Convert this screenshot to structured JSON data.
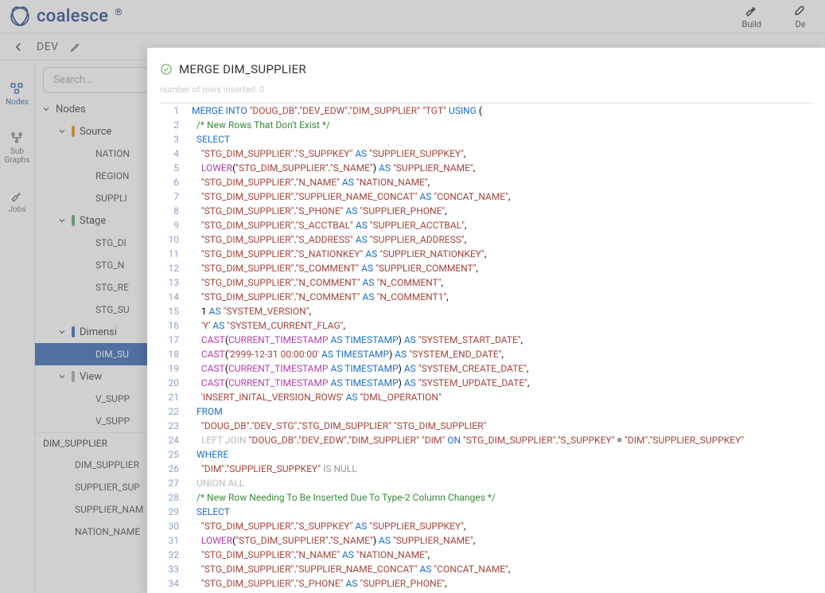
{
  "logo_text": "coalesce",
  "topbar": {
    "build": "Build",
    "deploy": "De"
  },
  "subbar": {
    "env": "DEV"
  },
  "rail": {
    "nodes": "Nodes",
    "subgraphs": "Sub\nGraphs",
    "jobs": "Jobs"
  },
  "search": {
    "placeholder": "Search..."
  },
  "tree": {
    "root": "Nodes",
    "source": {
      "label": "Source",
      "items": [
        "NATION",
        "REGION",
        "SUPPLI"
      ]
    },
    "stage": {
      "label": "Stage",
      "items": [
        "STG_DI",
        "STG_N",
        "STG_RE",
        "STG_SU"
      ]
    },
    "dimension": {
      "label": "Dimensi",
      "items": [
        "DIM_SU"
      ]
    },
    "view": {
      "label": "View",
      "items": [
        "V_SUPP",
        "V_SUPP"
      ]
    }
  },
  "detail": {
    "head": "DIM_SUPPLIER",
    "cols": [
      "DIM_SUPPLIER",
      "SUPPLIER_SUP",
      "SUPPLIER_NAM",
      "NATION_NAME"
    ]
  },
  "modal": {
    "title": "MERGE DIM_SUPPLIER",
    "status": "number of rows inserted: 0",
    "lines": [
      {
        "n": 1,
        "h": "<span class='tok-kw'>MERGE</span> <span class='tok-kw'>INTO</span> <span class='tok-str'>\"DOUG_DB\"</span>.<span class='tok-str'>\"DEV_EDW\"</span>.<span class='tok-str'>\"DIM_SUPPLIER\"</span> <span class='tok-str'>\"TGT\"</span> <span class='tok-kw'>USING</span> ("
      },
      {
        "n": 2,
        "h": "  <span class='tok-com'>/* New Rows That Don't Exist */</span>"
      },
      {
        "n": 3,
        "h": "  <span class='tok-kw'>SELECT</span>"
      },
      {
        "n": 4,
        "h": "    <span class='tok-str'>\"STG_DIM_SUPPLIER\"</span>.<span class='tok-str'>\"S_SUPPKEY\"</span> <span class='tok-kw'>AS</span> <span class='tok-str'>\"SUPPLIER_SUPPKEY\"</span>,"
      },
      {
        "n": 5,
        "h": "    <span class='tok-fn'>LOWER</span>(<span class='tok-str'>\"STG_DIM_SUPPLIER\"</span>.<span class='tok-str'>\"S_NAME\"</span>) <span class='tok-kw'>AS</span> <span class='tok-str'>\"SUPPLIER_NAME\"</span>,"
      },
      {
        "n": 6,
        "h": "    <span class='tok-str'>\"STG_DIM_SUPPLIER\"</span>.<span class='tok-str'>\"N_NAME\"</span> <span class='tok-kw'>AS</span> <span class='tok-str'>\"NATION_NAME\"</span>,"
      },
      {
        "n": 7,
        "h": "    <span class='tok-str'>\"STG_DIM_SUPPLIER\"</span>.<span class='tok-str'>\"SUPPLIER_NAME_CONCAT\"</span> <span class='tok-kw'>AS</span> <span class='tok-str'>\"CONCAT_NAME\"</span>,"
      },
      {
        "n": 8,
        "h": "    <span class='tok-str'>\"STG_DIM_SUPPLIER\"</span>.<span class='tok-str'>\"S_PHONE\"</span> <span class='tok-kw'>AS</span> <span class='tok-str'>\"SUPPLIER_PHONE\"</span>,"
      },
      {
        "n": 9,
        "h": "    <span class='tok-str'>\"STG_DIM_SUPPLIER\"</span>.<span class='tok-str'>\"S_ACCTBAL\"</span> <span class='tok-kw'>AS</span> <span class='tok-str'>\"SUPPLIER_ACCTBAL\"</span>,"
      },
      {
        "n": 10,
        "h": "    <span class='tok-str'>\"STG_DIM_SUPPLIER\"</span>.<span class='tok-str'>\"S_ADDRESS\"</span> <span class='tok-kw'>AS</span> <span class='tok-str'>\"SUPPLIER_ADDRESS\"</span>,"
      },
      {
        "n": 11,
        "h": "    <span class='tok-str'>\"STG_DIM_SUPPLIER\"</span>.<span class='tok-str'>\"S_NATIONKEY\"</span> <span class='tok-kw'>AS</span> <span class='tok-str'>\"SUPPLIER_NATIONKEY\"</span>,"
      },
      {
        "n": 12,
        "h": "    <span class='tok-str'>\"STG_DIM_SUPPLIER\"</span>.<span class='tok-str'>\"S_COMMENT\"</span> <span class='tok-kw'>AS</span> <span class='tok-str'>\"SUPPLIER_COMMENT\"</span>,"
      },
      {
        "n": 13,
        "h": "    <span class='tok-str'>\"STG_DIM_SUPPLIER\"</span>.<span class='tok-str'>\"N_COMMENT\"</span> <span class='tok-kw'>AS</span> <span class='tok-str'>\"N_COMMENT\"</span>,"
      },
      {
        "n": 14,
        "h": "    <span class='tok-str'>\"STG_DIM_SUPPLIER\"</span>.<span class='tok-str'>\"N_COMMENT\"</span> <span class='tok-kw'>AS</span> <span class='tok-str'>\"N_COMMENT1\"</span>,"
      },
      {
        "n": 15,
        "h": "    1 <span class='tok-kw'>AS</span> <span class='tok-str'>\"SYSTEM_VERSION\"</span>,"
      },
      {
        "n": 16,
        "h": "    <span class='tok-str'>'Y'</span> <span class='tok-kw'>AS</span> <span class='tok-str'>\"SYSTEM_CURRENT_FLAG\"</span>,"
      },
      {
        "n": 17,
        "h": "    <span class='tok-fn'>CAST</span>(<span class='tok-fn'>CURRENT_TIMESTAMP</span> <span class='tok-kw'>AS</span> <span class='tok-kw'>TIMESTAMP</span>) <span class='tok-kw'>AS</span> <span class='tok-str'>\"SYSTEM_START_DATE\"</span>,"
      },
      {
        "n": 18,
        "h": "    <span class='tok-fn'>CAST</span>(<span class='tok-str'>'2999-12-31 00:00:00'</span> <span class='tok-kw'>AS</span> <span class='tok-kw'>TIMESTAMP</span>) <span class='tok-kw'>AS</span> <span class='tok-str'>\"SYSTEM_END_DATE\"</span>,"
      },
      {
        "n": 19,
        "h": "    <span class='tok-fn'>CAST</span>(<span class='tok-fn'>CURRENT_TIMESTAMP</span> <span class='tok-kw'>AS</span> <span class='tok-kw'>TIMESTAMP</span>) <span class='tok-kw'>AS</span> <span class='tok-str'>\"SYSTEM_CREATE_DATE\"</span>,"
      },
      {
        "n": 20,
        "h": "    <span class='tok-fn'>CAST</span>(<span class='tok-fn'>CURRENT_TIMESTAMP</span> <span class='tok-kw'>AS</span> <span class='tok-kw'>TIMESTAMP</span>) <span class='tok-kw'>AS</span> <span class='tok-str'>\"SYSTEM_UPDATE_DATE\"</span>,"
      },
      {
        "n": 21,
        "h": "    <span class='tok-str'>'INSERT_INITAL_VERSION_ROWS'</span> <span class='tok-kw'>AS</span> <span class='tok-str'>\"DML_OPERATION\"</span>"
      },
      {
        "n": 22,
        "h": "  <span class='tok-kw'>FROM</span>"
      },
      {
        "n": 23,
        "h": "    <span class='tok-str'>\"DOUG_DB\"</span>.<span class='tok-str'>\"DEV_STG\"</span>.<span class='tok-str'>\"STG_DIM_SUPPLIER\"</span> <span class='tok-str'>\"STG_DIM_SUPPLIER\"</span>"
      },
      {
        "n": 24,
        "h": "    <span class='tok-gray'>LEFT JOIN</span> <span class='tok-str'>\"DOUG_DB\"</span>.<span class='tok-str'>\"DEV_EDW\"</span>.<span class='tok-str'>\"DIM_SUPPLIER\"</span> <span class='tok-str'>\"DIM\"</span> <span class='tok-kw'>ON</span> <span class='tok-str'>\"STG_DIM_SUPPLIER\"</span>.<span class='tok-str'>\"S_SUPPKEY\"</span> = <span class='tok-str'>\"DIM\"</span>.<span class='tok-str'>\"SUPPLIER_SUPPKEY\"</span>"
      },
      {
        "n": 25,
        "h": "  <span class='tok-kw'>WHERE</span>"
      },
      {
        "n": 26,
        "h": "    <span class='tok-str'>\"DIM\"</span>.<span class='tok-str'>\"SUPPLIER_SUPPKEY\"</span> <span class='tok-null'>IS NULL</span>"
      },
      {
        "n": 27,
        "h": "  <span class='tok-gray'>UNION ALL</span>"
      },
      {
        "n": 28,
        "h": "  <span class='tok-com'>/* New Row Needing To Be Inserted Due To Type-2 Column Changes */</span>"
      },
      {
        "n": 29,
        "h": "  <span class='tok-kw'>SELECT</span>"
      },
      {
        "n": 30,
        "h": "    <span class='tok-str'>\"STG_DIM_SUPPLIER\"</span>.<span class='tok-str'>\"S_SUPPKEY\"</span> <span class='tok-kw'>AS</span> <span class='tok-str'>\"SUPPLIER_SUPPKEY\"</span>,"
      },
      {
        "n": 31,
        "h": "    <span class='tok-fn'>LOWER</span>(<span class='tok-str'>\"STG_DIM_SUPPLIER\"</span>.<span class='tok-str'>\"S_NAME\"</span>) <span class='tok-kw'>AS</span> <span class='tok-str'>\"SUPPLIER_NAME\"</span>,"
      },
      {
        "n": 32,
        "h": "    <span class='tok-str'>\"STG_DIM_SUPPLIER\"</span>.<span class='tok-str'>\"N_NAME\"</span> <span class='tok-kw'>AS</span> <span class='tok-str'>\"NATION_NAME\"</span>,"
      },
      {
        "n": 33,
        "h": "    <span class='tok-str'>\"STG_DIM_SUPPLIER\"</span>.<span class='tok-str'>\"SUPPLIER_NAME_CONCAT\"</span> <span class='tok-kw'>AS</span> <span class='tok-str'>\"CONCAT_NAME\"</span>,"
      },
      {
        "n": 34,
        "h": "    <span class='tok-str'>\"STG_DIM_SUPPLIER\"</span>.<span class='tok-str'>\"S_PHONE\"</span> <span class='tok-kw'>AS</span> <span class='tok-str'>\"SUPPLIER_PHONE\"</span>,"
      }
    ]
  }
}
